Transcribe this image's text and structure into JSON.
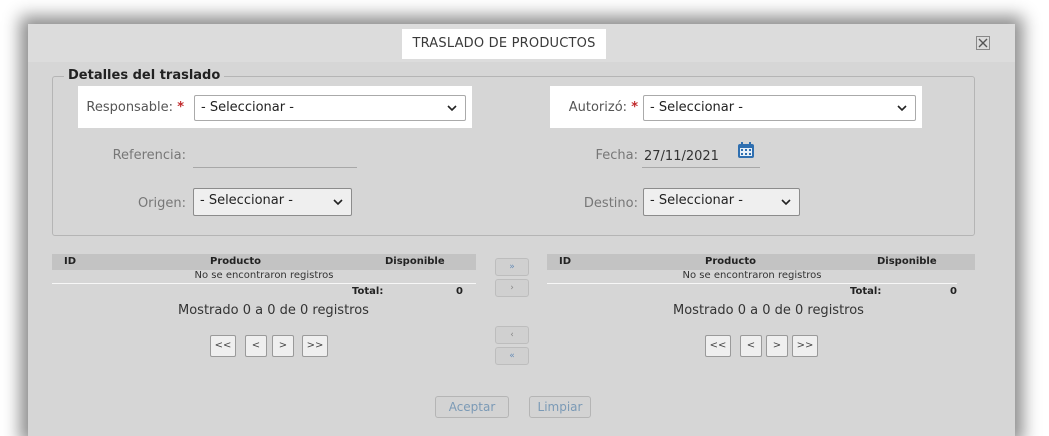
{
  "dialog": {
    "title": "TRASLADO DE PRODUCTOS",
    "close_icon": "close-icon"
  },
  "details": {
    "legend": "Detalles del traslado",
    "responsable": {
      "label": "Responsable:",
      "required_mark": "*",
      "value": "- Seleccionar -"
    },
    "autorizo": {
      "label": "Autorizó:",
      "required_mark": "*",
      "value": "- Seleccionar -"
    },
    "referencia": {
      "label": "Referencia:",
      "value": ""
    },
    "fecha": {
      "label": "Fecha:",
      "value": "27/11/2021",
      "icon": "calendar-icon"
    },
    "origen": {
      "label": "Origen:",
      "value": "- Seleccionar -"
    },
    "destino": {
      "label": "Destino:",
      "value": "- Seleccionar -"
    }
  },
  "left_grid": {
    "headers": [
      "ID",
      "Producto",
      "Disponible"
    ],
    "empty_text": "No se encontraron registros",
    "total_label": "Total:",
    "total_value": "0",
    "shown_text": "Mostrado 0 a 0 de 0 registros",
    "pager": [
      "<<",
      "<",
      ">",
      ">>"
    ]
  },
  "right_grid": {
    "headers": [
      "ID",
      "Producto",
      "Disponible"
    ],
    "empty_text": "No se encontraron registros",
    "total_label": "Total:",
    "total_value": "0",
    "shown_text": "Mostrado 0 a 0 de 0 registros",
    "pager": [
      "<<",
      "<",
      ">",
      ">>"
    ]
  },
  "move_buttons": [
    "»",
    "›",
    "‹",
    "«"
  ],
  "footer": {
    "accept": "Aceptar",
    "clear": "Limpiar"
  },
  "colors": {
    "required": "#c0292b",
    "calendar": "#2f6fb0",
    "button_text": "#7b9ab6"
  }
}
